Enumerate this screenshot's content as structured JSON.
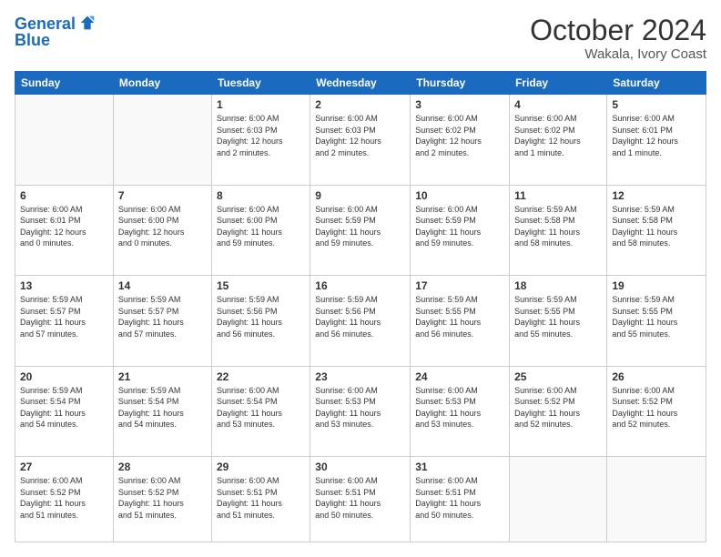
{
  "logo": {
    "line1": "General",
    "line2": "Blue"
  },
  "header": {
    "month": "October 2024",
    "location": "Wakala, Ivory Coast"
  },
  "weekdays": [
    "Sunday",
    "Monday",
    "Tuesday",
    "Wednesday",
    "Thursday",
    "Friday",
    "Saturday"
  ],
  "weeks": [
    [
      {
        "day": "",
        "info": ""
      },
      {
        "day": "",
        "info": ""
      },
      {
        "day": "1",
        "info": "Sunrise: 6:00 AM\nSunset: 6:03 PM\nDaylight: 12 hours\nand 2 minutes."
      },
      {
        "day": "2",
        "info": "Sunrise: 6:00 AM\nSunset: 6:03 PM\nDaylight: 12 hours\nand 2 minutes."
      },
      {
        "day": "3",
        "info": "Sunrise: 6:00 AM\nSunset: 6:02 PM\nDaylight: 12 hours\nand 2 minutes."
      },
      {
        "day": "4",
        "info": "Sunrise: 6:00 AM\nSunset: 6:02 PM\nDaylight: 12 hours\nand 1 minute."
      },
      {
        "day": "5",
        "info": "Sunrise: 6:00 AM\nSunset: 6:01 PM\nDaylight: 12 hours\nand 1 minute."
      }
    ],
    [
      {
        "day": "6",
        "info": "Sunrise: 6:00 AM\nSunset: 6:01 PM\nDaylight: 12 hours\nand 0 minutes."
      },
      {
        "day": "7",
        "info": "Sunrise: 6:00 AM\nSunset: 6:00 PM\nDaylight: 12 hours\nand 0 minutes."
      },
      {
        "day": "8",
        "info": "Sunrise: 6:00 AM\nSunset: 6:00 PM\nDaylight: 11 hours\nand 59 minutes."
      },
      {
        "day": "9",
        "info": "Sunrise: 6:00 AM\nSunset: 5:59 PM\nDaylight: 11 hours\nand 59 minutes."
      },
      {
        "day": "10",
        "info": "Sunrise: 6:00 AM\nSunset: 5:59 PM\nDaylight: 11 hours\nand 59 minutes."
      },
      {
        "day": "11",
        "info": "Sunrise: 5:59 AM\nSunset: 5:58 PM\nDaylight: 11 hours\nand 58 minutes."
      },
      {
        "day": "12",
        "info": "Sunrise: 5:59 AM\nSunset: 5:58 PM\nDaylight: 11 hours\nand 58 minutes."
      }
    ],
    [
      {
        "day": "13",
        "info": "Sunrise: 5:59 AM\nSunset: 5:57 PM\nDaylight: 11 hours\nand 57 minutes."
      },
      {
        "day": "14",
        "info": "Sunrise: 5:59 AM\nSunset: 5:57 PM\nDaylight: 11 hours\nand 57 minutes."
      },
      {
        "day": "15",
        "info": "Sunrise: 5:59 AM\nSunset: 5:56 PM\nDaylight: 11 hours\nand 56 minutes."
      },
      {
        "day": "16",
        "info": "Sunrise: 5:59 AM\nSunset: 5:56 PM\nDaylight: 11 hours\nand 56 minutes."
      },
      {
        "day": "17",
        "info": "Sunrise: 5:59 AM\nSunset: 5:55 PM\nDaylight: 11 hours\nand 56 minutes."
      },
      {
        "day": "18",
        "info": "Sunrise: 5:59 AM\nSunset: 5:55 PM\nDaylight: 11 hours\nand 55 minutes."
      },
      {
        "day": "19",
        "info": "Sunrise: 5:59 AM\nSunset: 5:55 PM\nDaylight: 11 hours\nand 55 minutes."
      }
    ],
    [
      {
        "day": "20",
        "info": "Sunrise: 5:59 AM\nSunset: 5:54 PM\nDaylight: 11 hours\nand 54 minutes."
      },
      {
        "day": "21",
        "info": "Sunrise: 5:59 AM\nSunset: 5:54 PM\nDaylight: 11 hours\nand 54 minutes."
      },
      {
        "day": "22",
        "info": "Sunrise: 6:00 AM\nSunset: 5:54 PM\nDaylight: 11 hours\nand 53 minutes."
      },
      {
        "day": "23",
        "info": "Sunrise: 6:00 AM\nSunset: 5:53 PM\nDaylight: 11 hours\nand 53 minutes."
      },
      {
        "day": "24",
        "info": "Sunrise: 6:00 AM\nSunset: 5:53 PM\nDaylight: 11 hours\nand 53 minutes."
      },
      {
        "day": "25",
        "info": "Sunrise: 6:00 AM\nSunset: 5:52 PM\nDaylight: 11 hours\nand 52 minutes."
      },
      {
        "day": "26",
        "info": "Sunrise: 6:00 AM\nSunset: 5:52 PM\nDaylight: 11 hours\nand 52 minutes."
      }
    ],
    [
      {
        "day": "27",
        "info": "Sunrise: 6:00 AM\nSunset: 5:52 PM\nDaylight: 11 hours\nand 51 minutes."
      },
      {
        "day": "28",
        "info": "Sunrise: 6:00 AM\nSunset: 5:52 PM\nDaylight: 11 hours\nand 51 minutes."
      },
      {
        "day": "29",
        "info": "Sunrise: 6:00 AM\nSunset: 5:51 PM\nDaylight: 11 hours\nand 51 minutes."
      },
      {
        "day": "30",
        "info": "Sunrise: 6:00 AM\nSunset: 5:51 PM\nDaylight: 11 hours\nand 50 minutes."
      },
      {
        "day": "31",
        "info": "Sunrise: 6:00 AM\nSunset: 5:51 PM\nDaylight: 11 hours\nand 50 minutes."
      },
      {
        "day": "",
        "info": ""
      },
      {
        "day": "",
        "info": ""
      }
    ]
  ]
}
